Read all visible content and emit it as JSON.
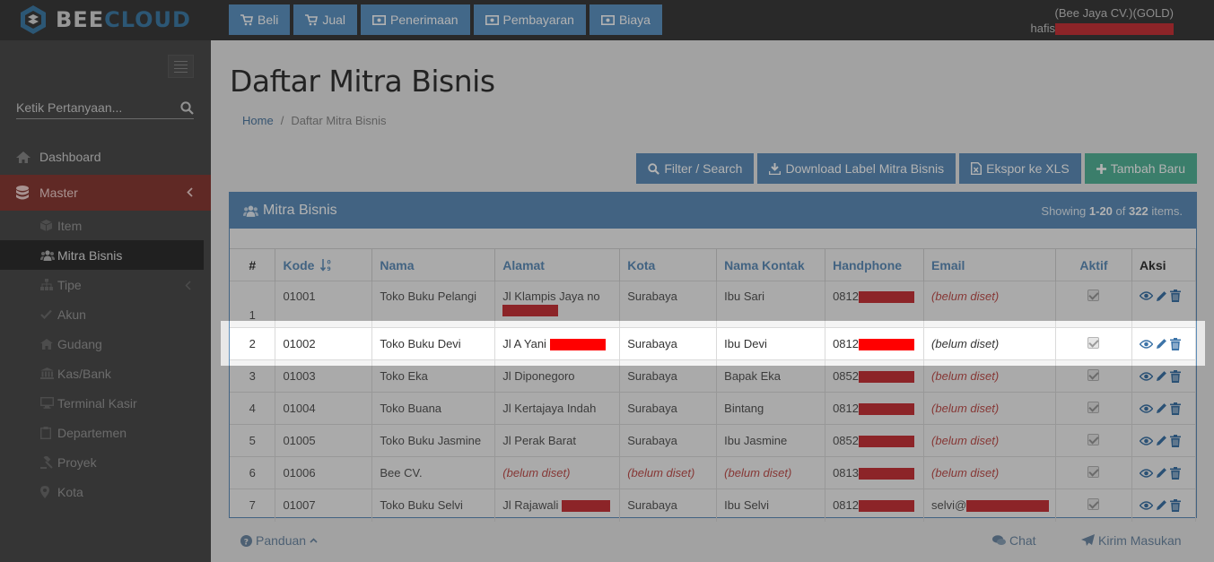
{
  "app": {
    "logo_bee": "BEE",
    "logo_cloud": "CLOUD"
  },
  "topnav": [
    {
      "label": "Beli",
      "icon": "cart-icon"
    },
    {
      "label": "Jual",
      "icon": "cart-icon"
    },
    {
      "label": "Penerimaan",
      "icon": "money-icon"
    },
    {
      "label": "Pembayaran",
      "icon": "money-icon"
    },
    {
      "label": "Biaya",
      "icon": "money-icon"
    }
  ],
  "user": {
    "company": "(Bee Jaya CV.)(GOLD)",
    "name_prefix": "hafis"
  },
  "sidebar": {
    "search_placeholder": "Ketik Pertanyaan...",
    "dashboard": "Dashboard",
    "master": "Master",
    "sub": [
      "Item",
      "Mitra Bisnis",
      "Tipe",
      "Akun",
      "Gudang",
      "Kas/Bank",
      "Terminal Kasir",
      "Departemen",
      "Proyek",
      "Kota"
    ]
  },
  "page": {
    "title": "Daftar Mitra Bisnis",
    "breadcrumb_home": "Home",
    "breadcrumb_sep": "/",
    "breadcrumb_current": "Daftar Mitra Bisnis"
  },
  "actions": {
    "filter": "Filter / Search",
    "download": "Download Label Mitra Bisnis",
    "export": "Ekspor ke XLS",
    "add": "Tambah Baru"
  },
  "panel": {
    "title": "Mitra Bisnis",
    "showing_prefix": "Showing ",
    "showing_range": "1-20",
    "showing_of": " of ",
    "showing_total": "322",
    "showing_suffix": " items."
  },
  "table": {
    "headers": [
      "#",
      "Kode",
      "Nama",
      "Alamat",
      "Kota",
      "Nama Kontak",
      "Handphone",
      "Email",
      "Aktif",
      "Aksi"
    ],
    "empty": "(belum diset)",
    "rows": [
      {
        "no": "1",
        "kode": "01001",
        "nama": "Toko Buku Pelangi",
        "alamat": "Jl Klampis Jaya no",
        "kota": "Surabaya",
        "kontak": "Ibu Sari",
        "hp": "0812",
        "email": ""
      },
      {
        "no": "2",
        "kode": "01002",
        "nama": "Toko Buku Devi",
        "alamat": "Jl A Yani",
        "kota": "Surabaya",
        "kontak": "Ibu Devi",
        "hp": "0812",
        "email": ""
      },
      {
        "no": "3",
        "kode": "01003",
        "nama": "Toko Eka",
        "alamat": "Jl Diponegoro",
        "kota": "Surabaya",
        "kontak": "Bapak Eka",
        "hp": "0852",
        "email": ""
      },
      {
        "no": "4",
        "kode": "01004",
        "nama": "Toko Buana",
        "alamat": "Jl Kertajaya Indah",
        "kota": "Surabaya",
        "kontak": "Bintang",
        "hp": "0812",
        "email": ""
      },
      {
        "no": "5",
        "kode": "01005",
        "nama": "Toko Buku Jasmine",
        "alamat": "Jl Perak Barat",
        "kota": "Surabaya",
        "kontak": "Ibu Jasmine",
        "hp": "0852",
        "email": ""
      },
      {
        "no": "6",
        "kode": "01006",
        "nama": "Bee CV.",
        "alamat": "",
        "kota": "",
        "kontak": "",
        "hp": "0813",
        "email": ""
      },
      {
        "no": "7",
        "kode": "01007",
        "nama": "Toko Buku Selvi",
        "alamat": "Jl Rajawali",
        "kota": "Surabaya",
        "kontak": "Ibu Selvi",
        "hp": "0812",
        "email": "selvi@"
      }
    ]
  },
  "footer": {
    "panduan": "Panduan",
    "chat": "Chat",
    "kirim": "Kirim Masukan"
  },
  "colors": {
    "accent": "#5f8fba",
    "danger": "#c0504d",
    "success": "#55b59a"
  }
}
